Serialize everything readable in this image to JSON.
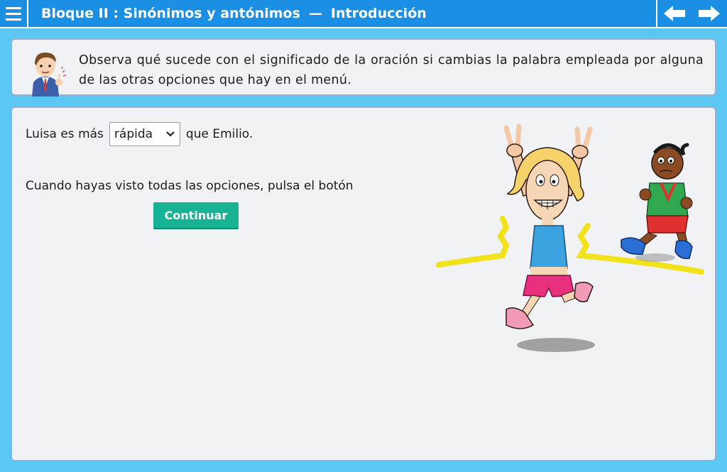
{
  "header": {
    "title_part1": "Bloque II : Sinónimos y antónimos",
    "separator": "—",
    "title_part2": "Introducción"
  },
  "instruction": {
    "text": "Observa qué sucede con el significado de la oración si cambias la palabra empleada por alguna de las otras opciones que hay en el menú."
  },
  "exercise": {
    "sentence_before": "Luisa es más",
    "select_value": "rápida",
    "sentence_after": "que Emilio.",
    "hint": "Cuando hayas visto todas las opciones, pulsa el botón",
    "continue_label": "Continuar"
  },
  "colors": {
    "background": "#5bc8f3",
    "header": "#1a8fe3",
    "button": "#18b394",
    "panel": "#f0f2f6"
  },
  "icons": {
    "menu": "hamburger-icon",
    "prev": "arrow-left-icon",
    "next": "arrow-right-icon",
    "select": "chevron-down-icon"
  }
}
